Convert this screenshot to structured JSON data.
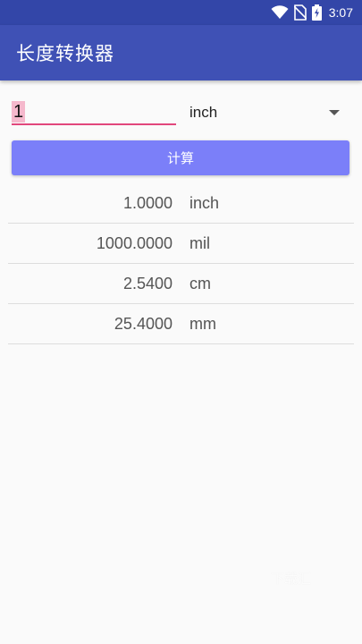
{
  "status_bar": {
    "time": "3:07",
    "icons": [
      "wifi-icon",
      "no-sim-icon",
      "battery-charging-icon"
    ]
  },
  "app_bar": {
    "title": "长度转换器"
  },
  "converter": {
    "input_value": "1",
    "selected_unit": "inch",
    "calculate_label": "计算"
  },
  "results": [
    {
      "value": "1.0000",
      "unit": "inch"
    },
    {
      "value": "1000.0000",
      "unit": "mil"
    },
    {
      "value": "2.5400",
      "unit": "cm"
    },
    {
      "value": "25.4000",
      "unit": "mm"
    }
  ],
  "watermark": {
    "text": "下载汇"
  },
  "colors": {
    "status_bar": "#3346a8",
    "app_bar": "#3f51b5",
    "accent_underline": "#e2477c",
    "button": "#7b7ff9"
  }
}
